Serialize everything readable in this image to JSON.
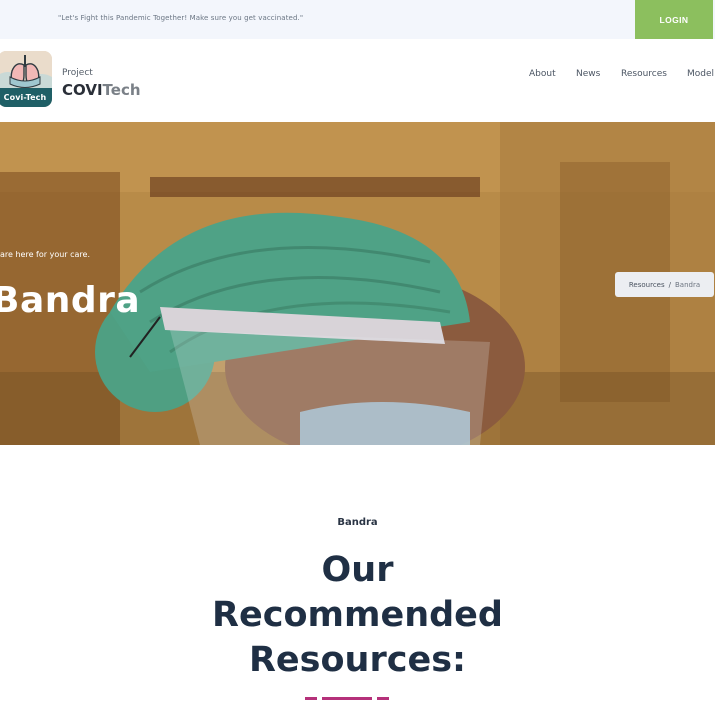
{
  "topbar": {
    "message": "\"Let's Fight this Pandemic Together! Make sure you get vaccinated.\"",
    "login_label": "LOGIN"
  },
  "brand": {
    "logo_caption": "Covi-Tech",
    "small": "Project",
    "main_bold": "COVI",
    "main_light": "Tech"
  },
  "nav": {
    "items": [
      "About",
      "News",
      "Resources",
      "Model"
    ]
  },
  "hero": {
    "subtitle": "are here for your care.",
    "title": "Bandra",
    "breadcrumb": {
      "parent": "Resources",
      "separator": "/",
      "current": "Bandra"
    }
  },
  "section": {
    "kicker": "Bandra",
    "title_lines": [
      "Our",
      "Recommended",
      "Resources:"
    ]
  },
  "colors": {
    "login_bg": "#8cbf5e",
    "heading": "#1f2f44",
    "divider": "#b5317a",
    "logo_caption_bg": "#1f5f66"
  }
}
